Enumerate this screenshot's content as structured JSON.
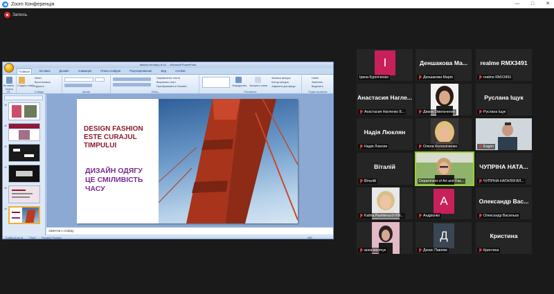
{
  "window": {
    "title": "Zoom Конференція",
    "controls": [
      "—",
      "□",
      "✕"
    ]
  },
  "recording": {
    "label": "Запись"
  },
  "colors": {
    "brand": "#2d8cff",
    "recording": "#e02828",
    "active_speaker": "#9ad334",
    "mic_muted": "#e03a3a",
    "slide_en": "#8e1a2a",
    "slide_uk": "#7a2a8e"
  },
  "ppt": {
    "doc_title": "fashion-frendary 8-04.. - Microsoft PowerPoint",
    "tabs": [
      "Главная",
      "Вставка",
      "Дизайн",
      "Анимация",
      "Показ слайдов",
      "Рецензирование",
      "Вид",
      "Acrobat"
    ],
    "ribbon": {
      "clipboard": {
        "label": "Буфер об...",
        "paste": "Вставить"
      },
      "slides": {
        "label": "Слайды",
        "new_slide": "Создать слайд",
        "items": [
          "Макет",
          "Восстановить",
          "Удалить"
        ]
      },
      "font": {
        "label": "Шрифт"
      },
      "paragraph": {
        "label": "Абзац",
        "items": [
          "Направление текста",
          "Выровнять текст",
          "Преобразовать в SmartArt"
        ]
      },
      "drawing": {
        "label": "Рисование",
        "arrange": "Упорядочить",
        "quick_styles": "Экспресс-стили",
        "items": [
          "Заливка фигуры",
          "Контур фигуры",
          "Эффекты для фигур"
        ]
      },
      "editing": {
        "label": "Редактирование",
        "items": [
          "Найти",
          "Заменить",
          "Выделить"
        ]
      }
    },
    "notes_placeholder": "Заметки к слайду",
    "status": {
      "slide": "Слайд 44 из 44",
      "theme": "\"Углы\"",
      "lang": "Русский (Россия)",
      "zoom": "48%"
    },
    "slide": {
      "title_en": [
        "DESIGN FASHION",
        "ESTE CURAJUL",
        "TIMPULUI"
      ],
      "title_uk": [
        "ДИЗАЙН ОДЯГУ",
        "ЦЕ СМІЛИВІСТЬ",
        "ЧАСУ"
      ]
    }
  },
  "participants": [
    {
      "name": "Ірина Курочченко",
      "avatar_letter": "І",
      "avatar_color": "#c8205a",
      "muted": false
    },
    {
      "big": "Деншакова Ма...",
      "name": "Деншакова Марія",
      "muted": true
    },
    {
      "big": "realme RMX3491",
      "name": "realme RMX3491",
      "muted": true
    },
    {
      "big": "Анастасия Нагле...",
      "name": "Анастасия Нагленко Б...",
      "muted": true
    },
    {
      "name": "Диана Омельченко",
      "video": "woman-dark",
      "muted": true
    },
    {
      "big": "Руслана Іщук",
      "name": "Руслана Іщук",
      "muted": true
    },
    {
      "big": "Надія Люклян",
      "name": "Надія Люклян",
      "muted": true
    },
    {
      "name": "Олена Колосніченко",
      "video": "woman-blonde",
      "muted": true
    },
    {
      "name": "Eugen",
      "video": "man",
      "muted": true
    },
    {
      "big": "Віталій",
      "name": "Віталій",
      "muted": true
    },
    {
      "name": "Department of Art and Fas...",
      "video": "woman-glasses",
      "active": true,
      "muted": false
    },
    {
      "big": "ЧУПРІНА НАТА...",
      "name": "ЧУПРІНА НАТАЛІЯ ВЛ...",
      "muted": true
    },
    {
      "name": "Kalina Pashkevych KN...",
      "video": "woman-fair",
      "muted": true
    },
    {
      "name": "Андрієнко",
      "avatar_letter": "А",
      "avatar_color": "#c8205a",
      "muted": true
    },
    {
      "big": "Олександр Вас...",
      "name": "Олександр Васильєв",
      "muted": true
    },
    {
      "name": "анна косячук",
      "video": "woman-pink",
      "muted": true
    },
    {
      "name": "Денис Павлюк",
      "avatar_letter": "Д",
      "avatar_color": "#3a4654",
      "muted": true
    },
    {
      "big": "Кристина",
      "name": "Кристина",
      "muted": true
    }
  ]
}
